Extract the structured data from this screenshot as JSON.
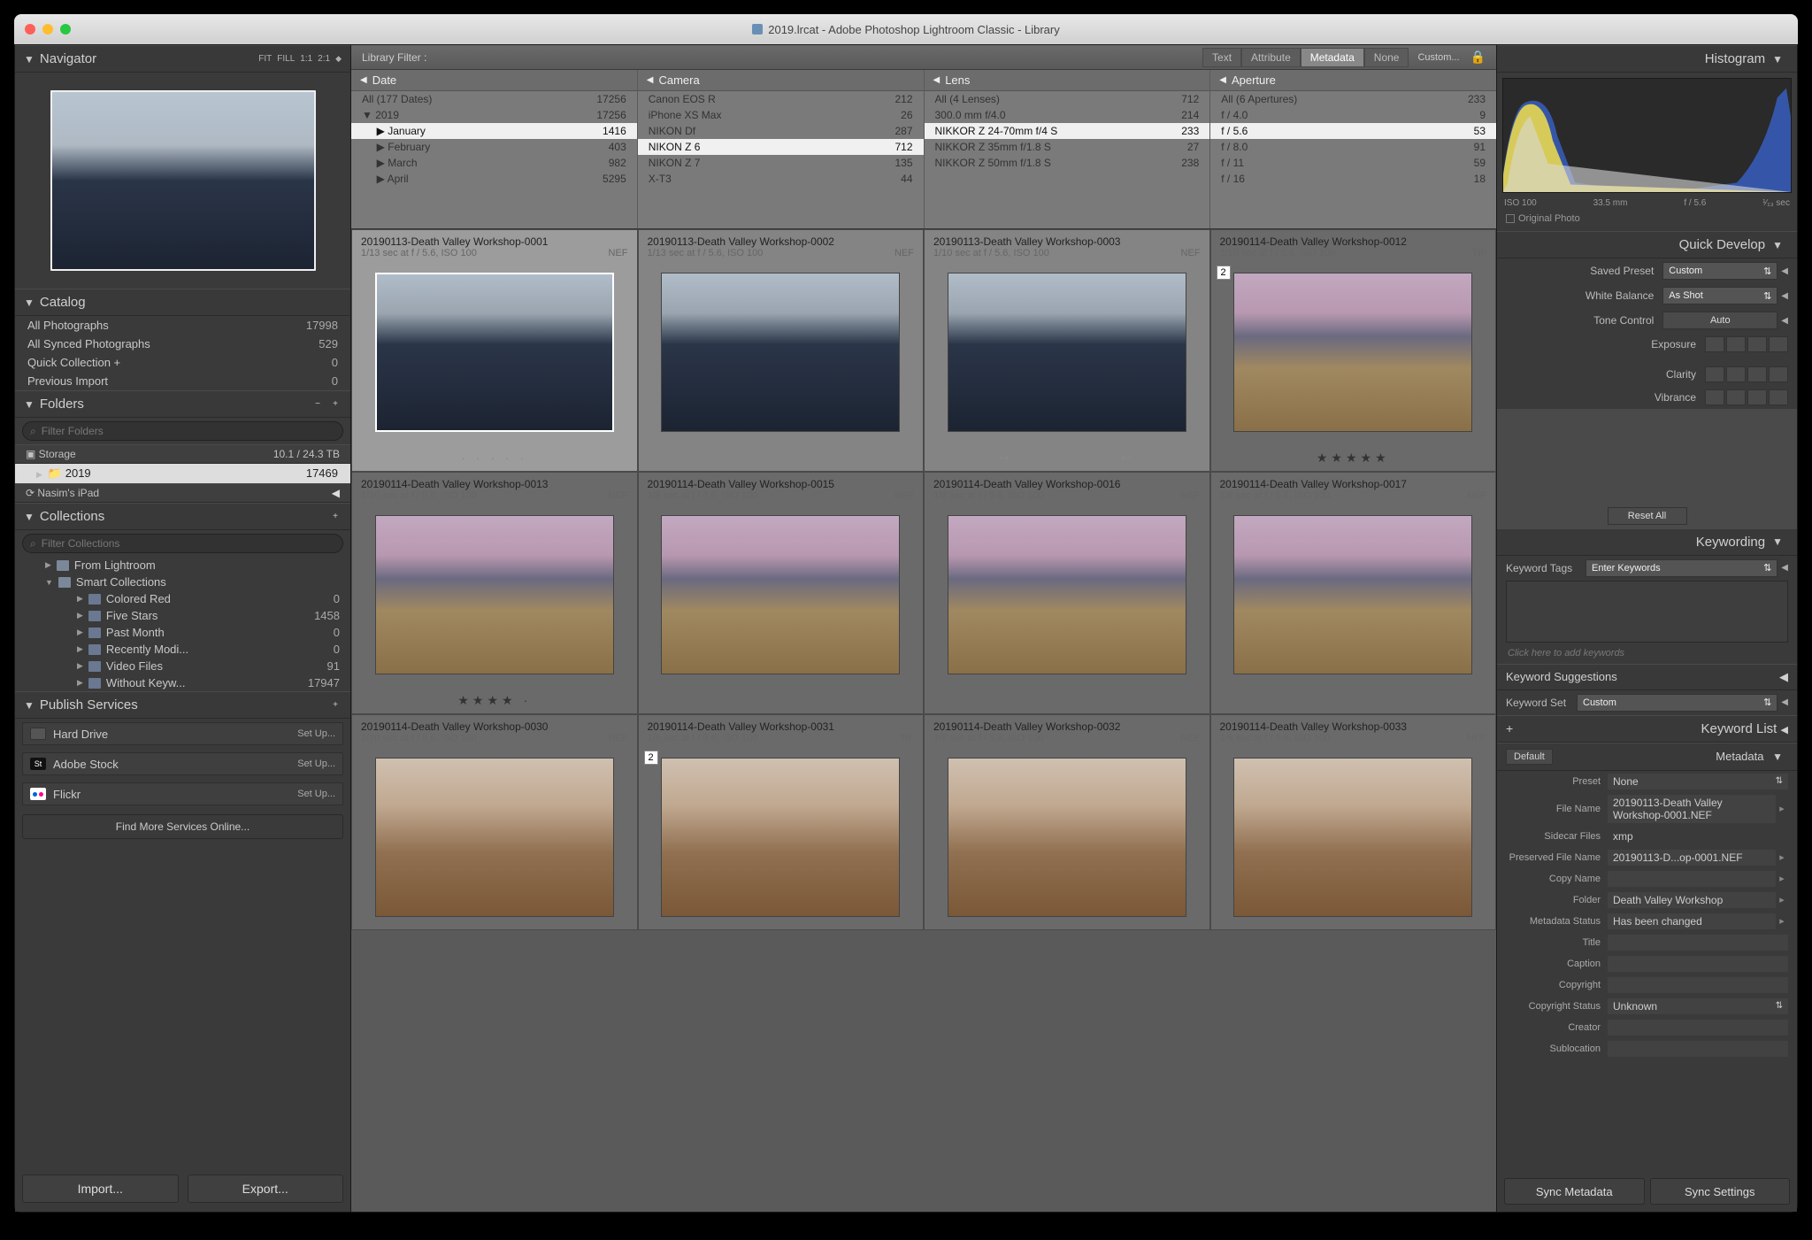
{
  "title": "2019.lrcat - Adobe Photoshop Lightroom Classic - Library",
  "navigator": {
    "title": "Navigator",
    "modes": [
      "FIT",
      "FILL",
      "1:1",
      "2:1"
    ]
  },
  "catalog": {
    "title": "Catalog",
    "items": [
      {
        "label": "All Photographs",
        "count": "17998"
      },
      {
        "label": "All Synced Photographs",
        "count": "529"
      },
      {
        "label": "Quick Collection  +",
        "count": "0"
      },
      {
        "label": "Previous Import",
        "count": "0"
      }
    ]
  },
  "folders": {
    "title": "Folders",
    "filter_placeholder": "Filter Folders",
    "storage_label": "Storage",
    "storage_stat": "10.1 / 24.3 TB",
    "year_label": "2019",
    "year_count": "17469",
    "ipad_label": "Nasim's iPad"
  },
  "collections": {
    "title": "Collections",
    "filter_placeholder": "Filter Collections",
    "from_lr": "From Lightroom",
    "smart": "Smart Collections",
    "items": [
      {
        "label": "Colored Red",
        "count": "0"
      },
      {
        "label": "Five Stars",
        "count": "1458"
      },
      {
        "label": "Past Month",
        "count": "0"
      },
      {
        "label": "Recently Modi...",
        "count": "0"
      },
      {
        "label": "Video Files",
        "count": "91"
      },
      {
        "label": "Without Keyw...",
        "count": "17947"
      }
    ]
  },
  "publish": {
    "title": "Publish Services",
    "items": [
      {
        "label": "Hard Drive",
        "setup": "Set Up..."
      },
      {
        "label": "Adobe Stock",
        "setup": "Set Up..."
      },
      {
        "label": "Flickr",
        "setup": "Set Up..."
      }
    ],
    "find_more": "Find More Services Online..."
  },
  "import_label": "Import...",
  "export_label": "Export...",
  "libfilter": {
    "label": "Library Filter :",
    "tabs": [
      "Text",
      "Attribute",
      "Metadata",
      "None"
    ],
    "custom": "Custom..."
  },
  "metacols": [
    {
      "title": "Date",
      "rows": [
        {
          "label": "All (177 Dates)",
          "count": "17256"
        },
        {
          "label": "2019",
          "count": "17256",
          "tri": "down"
        },
        {
          "label": "January",
          "count": "1416",
          "sel": true,
          "indent": true
        },
        {
          "label": "February",
          "count": "403",
          "indent": true
        },
        {
          "label": "March",
          "count": "982",
          "indent": true
        },
        {
          "label": "April",
          "count": "5295",
          "indent": true
        }
      ]
    },
    {
      "title": "Camera",
      "rows": [
        {
          "label": "Canon EOS R",
          "count": "212"
        },
        {
          "label": "iPhone XS Max",
          "count": "26"
        },
        {
          "label": "NIKON Df",
          "count": "287"
        },
        {
          "label": "NIKON Z 6",
          "count": "712",
          "sel": true
        },
        {
          "label": "NIKON Z 7",
          "count": "135"
        },
        {
          "label": "X-T3",
          "count": "44"
        }
      ]
    },
    {
      "title": "Lens",
      "rows": [
        {
          "label": "All (4 Lenses)",
          "count": "712"
        },
        {
          "label": "300.0 mm f/4.0",
          "count": "214"
        },
        {
          "label": "NIKKOR Z 24-70mm f/4 S",
          "count": "233",
          "sel": true
        },
        {
          "label": "NIKKOR Z 35mm f/1.8 S",
          "count": "27"
        },
        {
          "label": "NIKKOR Z 50mm f/1.8 S",
          "count": "238"
        }
      ]
    },
    {
      "title": "Aperture",
      "rows": [
        {
          "label": "All (6 Apertures)",
          "count": "233"
        },
        {
          "label": "f / 4.0",
          "count": "9"
        },
        {
          "label": "f / 5.6",
          "count": "53",
          "sel": true
        },
        {
          "label": "f / 8.0",
          "count": "91"
        },
        {
          "label": "f / 11",
          "count": "59"
        },
        {
          "label": "f / 16",
          "count": "18"
        }
      ]
    }
  ],
  "grid": [
    [
      {
        "title": "20190113-Death Valley Workshop-0001",
        "sub": "1/13 sec at f / 5.6, ISO 100",
        "fmt": "NEF",
        "kind": "dark",
        "bright": true,
        "selected": true,
        "dots": true
      },
      {
        "title": "20190113-Death Valley Workshop-0002",
        "sub": "1/13 sec at f / 5.6, ISO 100",
        "fmt": "NEF",
        "kind": "dark",
        "mid": true,
        "dots": true
      },
      {
        "title": "20190113-Death Valley Workshop-0003",
        "sub": "1/10 sec at f / 5.6, ISO 100",
        "fmt": "NEF",
        "kind": "dark",
        "mid": true,
        "dots": true,
        "arrows": true
      },
      {
        "title": "20190114-Death Valley Workshop-0012",
        "sub": "1/10 sec at f / 5.6, ISO 100",
        "fmt": "TIF",
        "kind": "pink",
        "stars": 5,
        "badge": "2"
      }
    ],
    [
      {
        "title": "20190114-Death Valley Workshop-0013",
        "sub": "1/10 sec at f / 5.6, ISO 100",
        "fmt": "NEF",
        "kind": "pink",
        "stars": 4,
        "half": true
      },
      {
        "title": "20190114-Death Valley Workshop-0015",
        "sub": "1/8 sec at f / 5.6, ISO 100",
        "fmt": "NEF",
        "kind": "pink"
      },
      {
        "title": "20190114-Death Valley Workshop-0016",
        "sub": "1/8 sec at f / 5.6, ISO 100",
        "fmt": "NEF",
        "kind": "pink"
      },
      {
        "title": "20190114-Death Valley Workshop-0017",
        "sub": "1/6 sec at f / 5.6, ISO 100",
        "fmt": "NEF",
        "kind": "pink"
      }
    ],
    [
      {
        "title": "20190114-Death Valley Workshop-0030",
        "sub": "1/10 sec at f / 5.6, ISO 100",
        "fmt": "NEF",
        "kind": "sunset"
      },
      {
        "title": "20190114-Death Valley Workshop-0031",
        "sub": "1/6 sec at f / 5.6, ISO 100",
        "fmt": "TIF",
        "kind": "sunset",
        "badge": "2"
      },
      {
        "title": "20190114-Death Valley Workshop-0032",
        "sub": "1/6 sec at f / 5.6, ISO 100",
        "fmt": "NEF",
        "kind": "sunset"
      },
      {
        "title": "20190114-Death Valley Workshop-0033",
        "sub": "1/6 sec at f / 5.6, ISO 100",
        "fmt": "NEF",
        "kind": "sunset"
      }
    ]
  ],
  "histogram": {
    "title": "Histogram",
    "labels": [
      "ISO 100",
      "33.5 mm",
      "f / 5.6",
      "¹⁄₁₃ sec"
    ],
    "original": "Original Photo"
  },
  "quickdev": {
    "title": "Quick Develop",
    "saved_preset_lbl": "Saved Preset",
    "saved_preset_val": "Custom",
    "wb_lbl": "White Balance",
    "wb_val": "As Shot",
    "tone_lbl": "Tone Control",
    "auto": "Auto",
    "exposure": "Exposure",
    "clarity": "Clarity",
    "vibrance": "Vibrance",
    "reset": "Reset All"
  },
  "keywording": {
    "title": "Keywording",
    "tags_lbl": "Keyword Tags",
    "tags_sel": "Enter Keywords",
    "hint": "Click here to add keywords",
    "sugg": "Keyword Suggestions",
    "set_lbl": "Keyword Set",
    "set_val": "Custom"
  },
  "keywordlist": {
    "title": "Keyword List",
    "default": "Default"
  },
  "metadata": {
    "title": "Metadata",
    "preset_lbl": "Preset",
    "preset_val": "None",
    "rows": [
      {
        "lbl": "File Name",
        "val": "20190113-Death Valley Workshop-0001.NEF",
        "icon": true
      },
      {
        "lbl": "Sidecar Files",
        "val": "xmp",
        "plain": true
      },
      {
        "lbl": "Preserved File Name",
        "val": "20190113-D...op-0001.NEF",
        "icon": true
      },
      {
        "lbl": "Copy Name",
        "val": "",
        "icon": true
      },
      {
        "lbl": "Folder",
        "val": "Death Valley Workshop",
        "icon": true
      },
      {
        "lbl": "Metadata Status",
        "val": "Has been changed",
        "icon": true
      },
      {
        "lbl": "Title",
        "val": ""
      },
      {
        "lbl": "Caption",
        "val": ""
      },
      {
        "lbl": "Copyright",
        "val": ""
      },
      {
        "lbl": "Copyright Status",
        "val": "Unknown",
        "drop": true
      },
      {
        "lbl": "Creator",
        "val": ""
      },
      {
        "lbl": "Sublocation",
        "val": ""
      }
    ]
  },
  "sync": {
    "meta": "Sync Metadata",
    "settings": "Sync Settings"
  }
}
